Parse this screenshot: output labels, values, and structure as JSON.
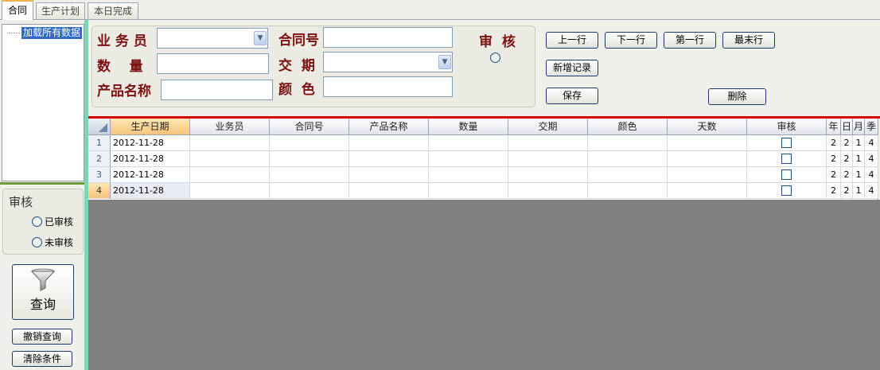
{
  "tabs": [
    {
      "label": "合同",
      "active": true
    },
    {
      "label": "生产计划",
      "active": false
    },
    {
      "label": "本日完成",
      "active": false
    }
  ],
  "tree": {
    "item": "加载所有数据"
  },
  "audit_filter": {
    "title": "审核",
    "options": [
      "已审核",
      "未审核"
    ]
  },
  "query_button": {
    "label": "查询",
    "icon": "funnel-icon"
  },
  "cancel_query": "撤销查询",
  "clear_conditions": "清除条件",
  "form": {
    "salesperson_label": "业 务 员",
    "quantity_label": "数    量",
    "product_name_label": "产品名称",
    "contract_no_label": "合同号",
    "delivery_label": "交  期",
    "color_label": "颜  色",
    "approve_label": "审  核",
    "salesperson_value": "",
    "quantity_value": "",
    "product_name_value": "",
    "contract_no_value": "",
    "delivery_value": "",
    "color_value": ""
  },
  "buttons": {
    "prev": "上一行",
    "next": "下一行",
    "first": "第一行",
    "last": "最末行",
    "add": "新增记录",
    "save": "保存",
    "delete": "删除"
  },
  "grid": {
    "columns": [
      "生产日期",
      "业务员",
      "合同号",
      "产品名称",
      "数量",
      "交期",
      "颜色",
      "天数",
      "审核",
      "年",
      "日",
      "月",
      "季"
    ],
    "rows": [
      {
        "no": "1",
        "date": "2012-11-28",
        "year": "2",
        "day": "2",
        "month": "1",
        "season": "4"
      },
      {
        "no": "2",
        "date": "2012-11-28",
        "year": "2",
        "day": "2",
        "month": "1",
        "season": "4"
      },
      {
        "no": "3",
        "date": "2012-11-28",
        "year": "2",
        "day": "2",
        "month": "1",
        "season": "4"
      },
      {
        "no": "4",
        "date": "2012-11-28",
        "year": "2",
        "day": "2",
        "month": "1",
        "season": "4"
      }
    ]
  },
  "colors": {
    "accent_red": "#d40000",
    "label_red": "#7b1010",
    "divider_teal": "#7fd4b8"
  }
}
